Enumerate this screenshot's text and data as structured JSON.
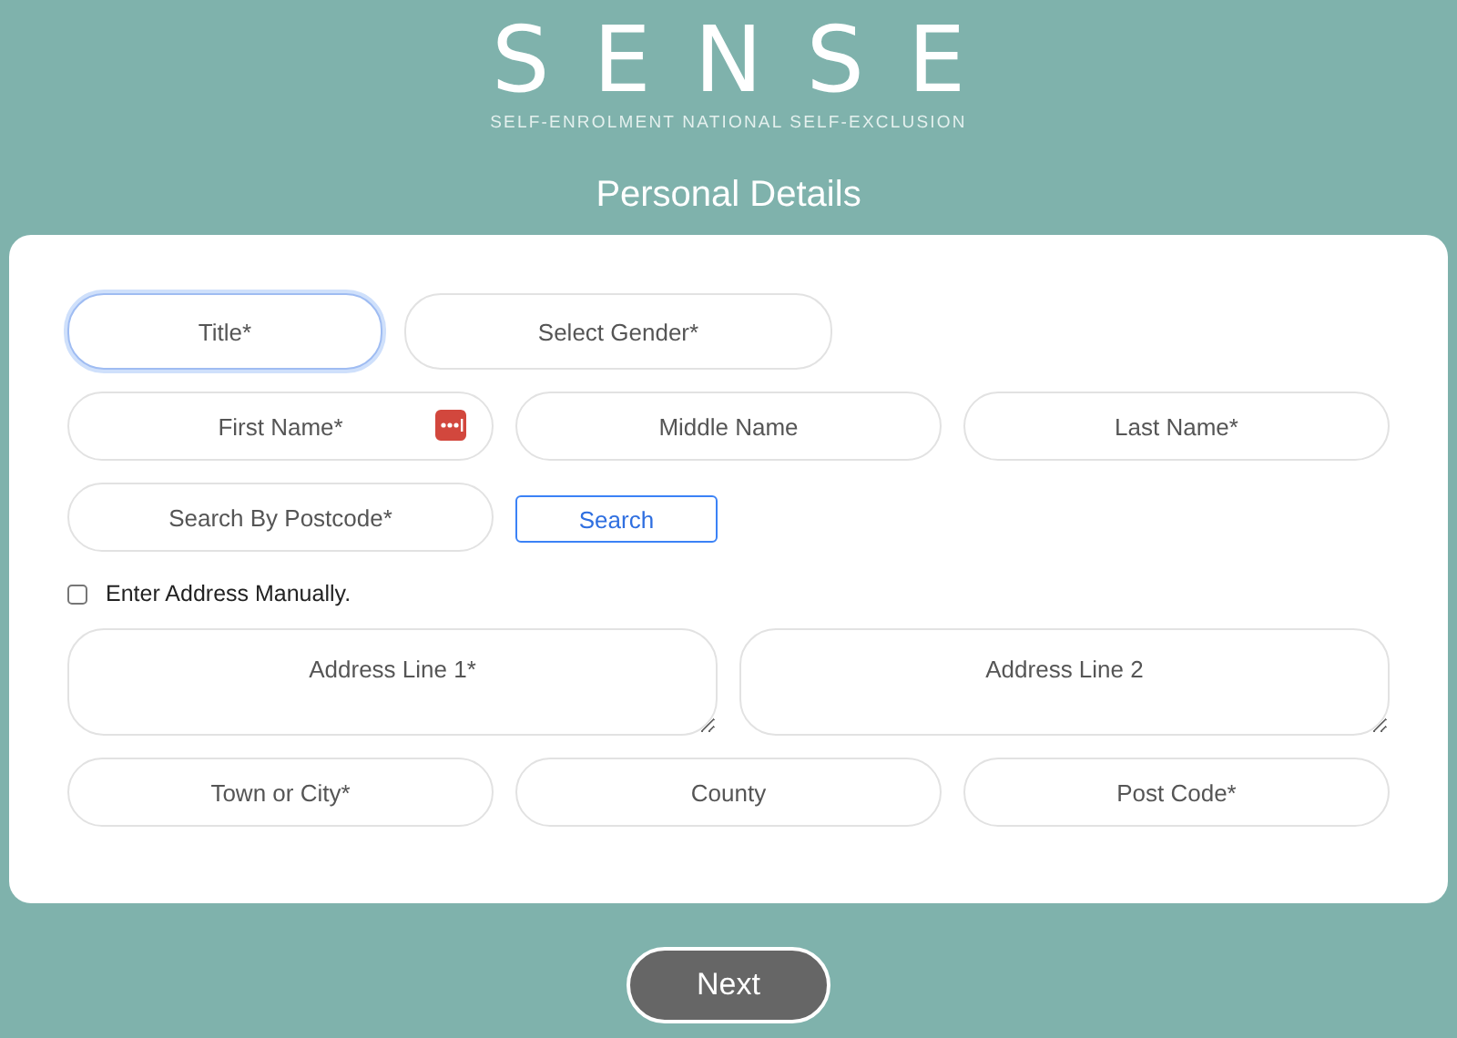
{
  "logo": {
    "name": "SENSE",
    "tagline": "SELF-ENROLMENT NATIONAL SELF-EXCLUSION"
  },
  "heading": "Personal Details",
  "form": {
    "rows": [
      {
        "kind": "pair",
        "items": [
          {
            "kind": "select",
            "placeholder": "Title*",
            "focused": true
          },
          {
            "kind": "select",
            "placeholder": "Select Gender*",
            "focused": false
          }
        ]
      },
      {
        "kind": "thirds",
        "items": [
          {
            "kind": "input",
            "placeholder": "First Name*",
            "focused": false,
            "autofill": true
          },
          {
            "kind": "input",
            "placeholder": "Middle Name",
            "focused": false
          },
          {
            "kind": "input",
            "placeholder": "Last Name*",
            "focused": false
          }
        ]
      },
      {
        "kind": "thirds",
        "items": [
          {
            "kind": "input",
            "placeholder": "Search By Postcode*",
            "focused": false
          },
          {
            "kind": "button",
            "label": "Search"
          }
        ]
      },
      {
        "kind": "single",
        "items": [
          {
            "kind": "checkbox",
            "label": "Enter Address Manually.",
            "checked": false
          }
        ]
      },
      {
        "kind": "halves",
        "items": [
          {
            "kind": "textarea",
            "placeholder": "Address Line 1*",
            "focused": false
          },
          {
            "kind": "textarea",
            "placeholder": "Address Line 2",
            "focused": false
          }
        ]
      },
      {
        "kind": "thirds",
        "items": [
          {
            "kind": "input",
            "placeholder": "Town or City*",
            "focused": false
          },
          {
            "kind": "input",
            "placeholder": "County",
            "focused": false
          },
          {
            "kind": "input",
            "placeholder": "Post Code*",
            "focused": false
          }
        ]
      }
    ]
  },
  "next_button": "Next"
}
